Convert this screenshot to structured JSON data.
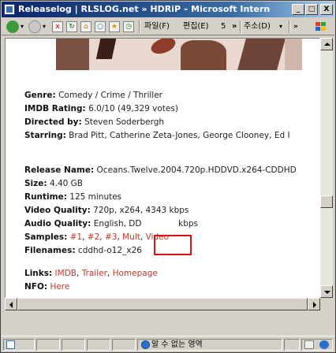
{
  "window": {
    "title": "Releaselog | RLSLOG.net » HDRiP – Microsoft Internet Exp...",
    "min_label": "_",
    "max_label": "□",
    "close_label": "X"
  },
  "toolbar": {
    "menu_file": "파일(F)",
    "menu_edit": "편집(E)",
    "menu_extra": "5",
    "overflow": "»",
    "address_label": "주소(D)"
  },
  "release": {
    "genre_label": "Genre:",
    "genre_value": "Comedy / Crime / Thriller",
    "imdb_label": "IMDB Rating:",
    "imdb_value": "6.0/10 (49,329 votes)",
    "directed_label": "Directed by:",
    "directed_value": "Steven Soderbergh",
    "starring_label": "Starring:",
    "starring_value": "Brad Pitt, Catherine Zeta-Jones, George Clooney, Ed I",
    "name_label": "Release Name:",
    "name_value": "Oceans.Twelve.2004.720p.HDDVD.x264-CDDHD",
    "size_label": "Size:",
    "size_value": "4.40 GB",
    "runtime_label": "Runtime:",
    "runtime_value": "125 minutes",
    "video_label": "Video Quality:",
    "video_value": "720p, x264, 4343 kbps",
    "audio_label": "Audio Quality:",
    "audio_value": "English, DD",
    "audio_value_tail": "kbps",
    "samples_label": "Samples:",
    "sample_1": "#1",
    "sample_2": "#2",
    "sample_3": "#3",
    "sample_multi": "Mult",
    "sample_video": "Video",
    "filenames_label": "Filenames:",
    "filenames_value": "cddhd-o12_x26",
    "links_label": "Links:",
    "link_imdb": "IMDB",
    "link_trailer": "Trailer",
    "link_homepage": "Homepage",
    "nfo_label": "NFO:",
    "nfo_link": "Here"
  },
  "status": {
    "zone_text": "알 수 없는 영역"
  },
  "colors": {
    "link": "#c0392b",
    "highlight": "#e01010",
    "titlebar_start": "#0a246a"
  }
}
